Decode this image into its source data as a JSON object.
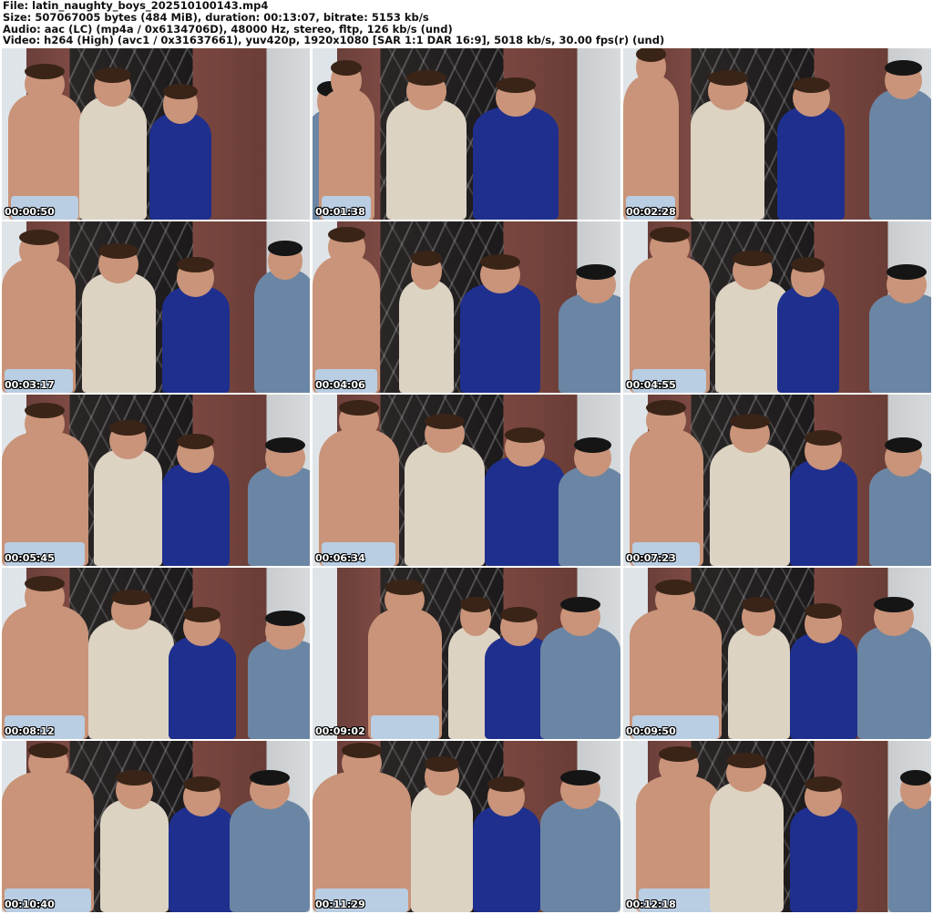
{
  "header": {
    "file": "File: latin_naughty_boys_202510100143.mp4",
    "size": "Size: 507067005 bytes (484 MiB), duration: 00:13:07, bitrate: 5153 kb/s",
    "audio": "Audio: aac (LC) (mp4a / 0x6134706D), 48000 Hz, stereo, fltp, 126 kb/s (und)",
    "video": "Video: h264 (High) (avc1 / 0x31637661), yuv420p, 1920x1080 [SAR 1:1 DAR 16:9], 5018 kb/s, 30.00 fps(r) (und)"
  },
  "thumbnails": [
    {
      "timestamp": "00:00:50"
    },
    {
      "timestamp": "00:01:38"
    },
    {
      "timestamp": "00:02:28"
    },
    {
      "timestamp": "00:03:17"
    },
    {
      "timestamp": "00:04:06"
    },
    {
      "timestamp": "00:04:55"
    },
    {
      "timestamp": "00:05:45"
    },
    {
      "timestamp": "00:06:34"
    },
    {
      "timestamp": "00:07:23"
    },
    {
      "timestamp": "00:08:12"
    },
    {
      "timestamp": "00:09:02"
    },
    {
      "timestamp": "00:09:50"
    },
    {
      "timestamp": "00:10:40"
    },
    {
      "timestamp": "00:11:29"
    },
    {
      "timestamp": "00:12:18"
    }
  ]
}
